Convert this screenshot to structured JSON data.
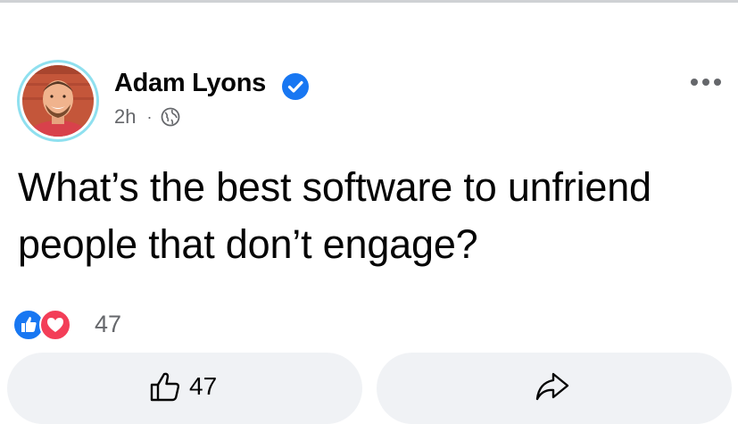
{
  "post": {
    "author_name": "Adam Lyons",
    "verified_icon": "verified-badge-icon",
    "time": "2h",
    "separator": "·",
    "privacy_icon": "globe-icon",
    "text": "What’s the best software to unfriend people that don’t engage?"
  },
  "reactions": {
    "icons": [
      "like-reaction-icon",
      "love-reaction-icon"
    ],
    "count": "47"
  },
  "actions": {
    "like_count": "47",
    "like_icon": "thumbs-up-icon",
    "share_icon": "share-arrow-icon"
  },
  "colors": {
    "brand_blue": "#1877f2",
    "love_red": "#f33e58",
    "secondary_text": "#65676b",
    "button_bg": "#f0f2f5",
    "avatar_ring": "#8fe0ef"
  }
}
